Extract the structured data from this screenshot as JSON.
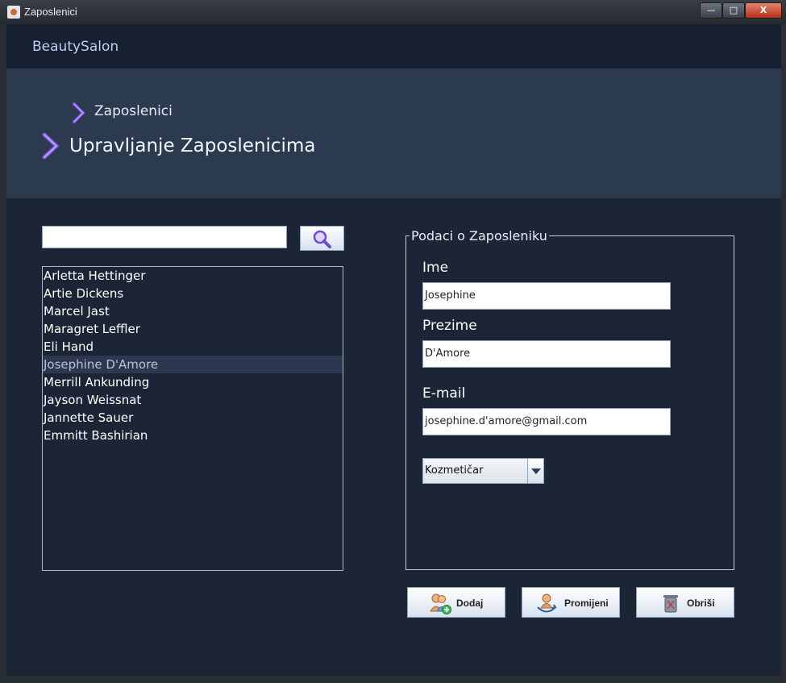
{
  "window": {
    "title": "Zaposlenici",
    "controls": {
      "minimize": "—",
      "maximize": "□",
      "close": "X"
    }
  },
  "app": {
    "brand": "BeautySalon"
  },
  "hero": {
    "breadcrumb": "Zaposlenici",
    "heading": "Upravljanje Zaposlenicima"
  },
  "search": {
    "value": "",
    "button_icon": "magnifier-icon"
  },
  "employees": {
    "items": [
      "Arletta Hettinger",
      "Artie Dickens",
      "Marcel Jast",
      "Maragret Leffler",
      "Eli Hand",
      "Josephine D'Amore",
      "Merrill Ankunding",
      "Jayson Weissnat",
      "Jannette Sauer",
      "Emmitt Bashirian"
    ],
    "selected": "Josephine D'Amore"
  },
  "form": {
    "legend": "Podaci o Zaposleniku",
    "first_name_label": "Ime",
    "first_name_value": "Josephine",
    "last_name_label": "Prezime",
    "last_name_value": "D'Amore",
    "email_label": "E-mail",
    "email_value": "josephine.d'amore@gmail.com",
    "role_selected": "Kozmetičar"
  },
  "actions": {
    "add_label": "Dodaj",
    "add_icon": "add-user-icon",
    "edit_label": "Promijeni",
    "edit_icon": "change-user-icon",
    "delete_label": "Obriši",
    "delete_icon": "trash-icon"
  },
  "colors": {
    "background": "#1c2536",
    "hero": "#2c3a50",
    "selection": "#2b3850",
    "brand_text": "#bcd0f0",
    "chevron_accent": "#8a5cff"
  }
}
